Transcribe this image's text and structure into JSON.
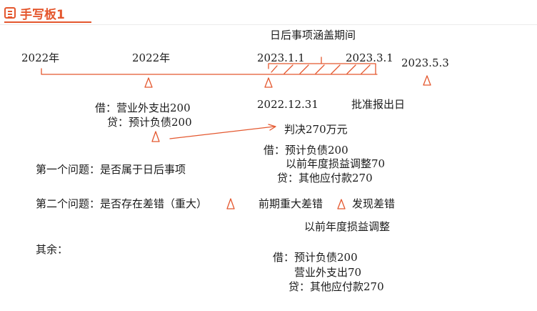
{
  "header": {
    "title": "手写板1"
  },
  "timeline": {
    "span_label": "日后事项涵盖期间",
    "left_year": "2022年",
    "mid_year": "2022年",
    "date_start": "2023.1.1",
    "date_end": "2023.3.1",
    "date_far": "2023.5.3",
    "balance_date": "2022.12.31",
    "approval_date": "批准报出日"
  },
  "entry1": {
    "debit": "借：营业外支出200",
    "credit": "贷：预计负债200"
  },
  "judgment": "判决270万元",
  "entry2": {
    "debit": "借：预计负债200",
    "line2": "以前年度损益调整70",
    "credit": "贷：其他应付款270"
  },
  "questions": {
    "q1": "第一个问题：是否属于日后事项",
    "q2": "第二个问题：是否存在差错（重大）",
    "q2_left": "前期重大差错",
    "q2_right": "发现差错",
    "adjust": "以前年度损益调整",
    "rest": "其余："
  },
  "entry3": {
    "debit": "借：预计负债200",
    "line2": "营业外支出70",
    "credit": "贷：其他应付款270"
  },
  "colors": {
    "accent": "#e4572e"
  }
}
